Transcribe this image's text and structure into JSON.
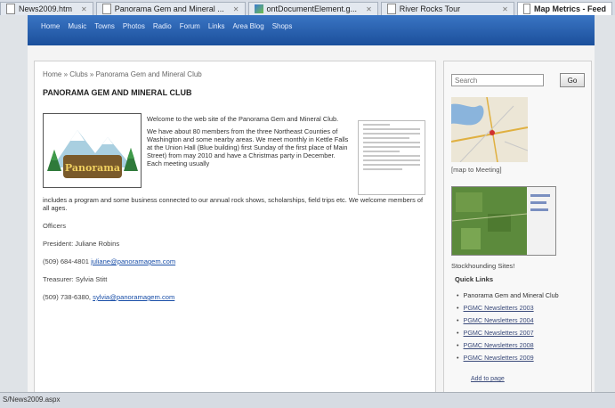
{
  "browser": {
    "tabs": [
      {
        "label": "News2009.htm",
        "active": false,
        "icon": "document-icon"
      },
      {
        "label": "Panorama Gem and Mineral ...",
        "active": false,
        "icon": "document-icon"
      },
      {
        "label": "ontDocumentElement.g...",
        "active": false,
        "icon": "favicon-icon"
      },
      {
        "label": "River Rocks Tour",
        "active": false,
        "icon": "document-icon"
      },
      {
        "label": "Map Metrics - Feed",
        "active": true,
        "icon": "document-icon"
      }
    ]
  },
  "nav": {
    "items": [
      "Home",
      "Music",
      "Towns",
      "Photos",
      "Radio",
      "Forum",
      "Links",
      "Area Blog",
      "Shops"
    ]
  },
  "breadcrumb": "Home » Clubs » Panorama Gem and Mineral Club",
  "page_title": "PANORAMA GEM AND MINERAL CLUB",
  "logo": {
    "text": "Panorama"
  },
  "intro": {
    "p1": "Welcome to the web site of the Panorama Gem and Mineral Club.",
    "p2": "We have about 80 members from the three Northeast Counties of Washington and some nearby areas. We meet monthly in Kettle Falls at the Union Hall (Blue building) first Sunday of the first place of Main Street) from may 2010 and have a Christmas party in December. Each meeting usually",
    "tail": "includes a program and some business connected to our annual rock shows, scholarships, field trips etc. We welcome members of all ages."
  },
  "officers": {
    "heading": "Officers",
    "president": "President: Juliane Robins",
    "president_phone": "(509) 684-4801",
    "president_email": "juliane@panoramagem.com",
    "treasurer": "Treasurer: Sylvia Stitt",
    "treasurer_phone": "(509) 738-6380,",
    "treasurer_email": "sylvia@panoramagem.com"
  },
  "sidebar": {
    "search_placeholder": "Search",
    "go_label": "Go",
    "map_caption": "[map to Meeting]",
    "sat_caption": "Stockhounding Sites!",
    "quicklinks_heading": "Quick Links",
    "quicklinks": [
      "Panorama Gem and Mineral Club",
      "PGMC Newsletters 2003",
      "PGMC Newsletters 2004",
      "PGMC Newsletters 2007",
      "PGMC Newsletters 2008",
      "PGMC Newsletters 2009"
    ],
    "more_label": "Add to page"
  },
  "status_bar": "S/News2009.aspx",
  "colors": {
    "nav_bar": "#1b4f9b",
    "link": "#1a4fa8",
    "page_bg": "#f4f4f4"
  }
}
